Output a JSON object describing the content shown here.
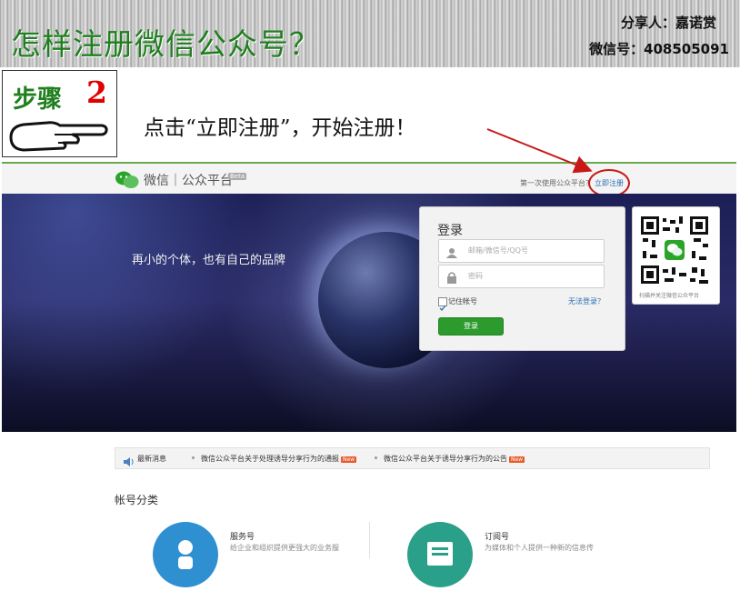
{
  "slide": {
    "title": "怎样注册微信公众号？",
    "sharer": "分享人：嘉诺赏",
    "wechat_id": "微信号：408505091",
    "step_label": "步骤",
    "step_number": "2",
    "instruction": "点击“立即注册”，开始注册！"
  },
  "wechat_page": {
    "brand": "微信｜公众平台",
    "beta": "Beta",
    "first_time_text": "第一次使用公众平台？",
    "register_link": "立即注册",
    "hero_tagline": "再小的个体，也有自己的品牌",
    "login": {
      "title": "登录",
      "email_placeholder": "邮箱/微信号/QQ号",
      "password_placeholder": "密码",
      "remember_label": "记住帐号",
      "forgot_link": "无法登录？",
      "button": "登录"
    },
    "qr_caption": "扫描并关注微信公众平台",
    "news": {
      "label": "最新消息",
      "items": [
        "微信公众平台关于处理诱导分享行为的通报",
        "微信公众平台关于诱导分享行为的公告"
      ],
      "badge": "New"
    },
    "account_types": {
      "heading": "帐号分类",
      "service_title": "服务号",
      "service_desc": "给企业和组织提供更强大的业务服",
      "subscription_title": "订阅号",
      "subscription_desc": "为媒体和个人提供一种新的信息传"
    }
  },
  "colors": {
    "title_green": "#1f7f1f",
    "step_red": "#e00000",
    "highlight_circle": "#c81818",
    "login_green": "#2c9a2c"
  }
}
